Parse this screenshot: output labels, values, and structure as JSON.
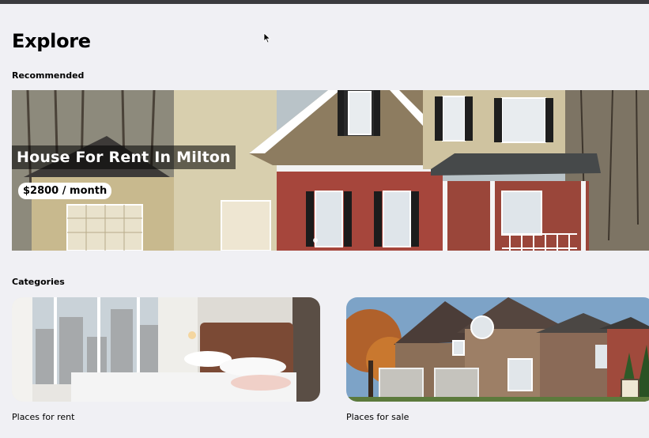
{
  "page": {
    "title": "Explore"
  },
  "recommended": {
    "heading": "Recommended",
    "featured": {
      "title": "House For Rent In Milton",
      "price": "$2800 / month"
    }
  },
  "categories": {
    "heading": "Categories",
    "items": [
      {
        "label": "Places for rent"
      },
      {
        "label": "Places for sale"
      }
    ]
  },
  "colors": {
    "background": "#f0f0f4",
    "top_bar": "#3a3a3e",
    "title_overlay": "rgba(0,0,0,0.55)",
    "price_pill": "#ffffff"
  },
  "icons": [
    "mouse-cursor-icon"
  ]
}
